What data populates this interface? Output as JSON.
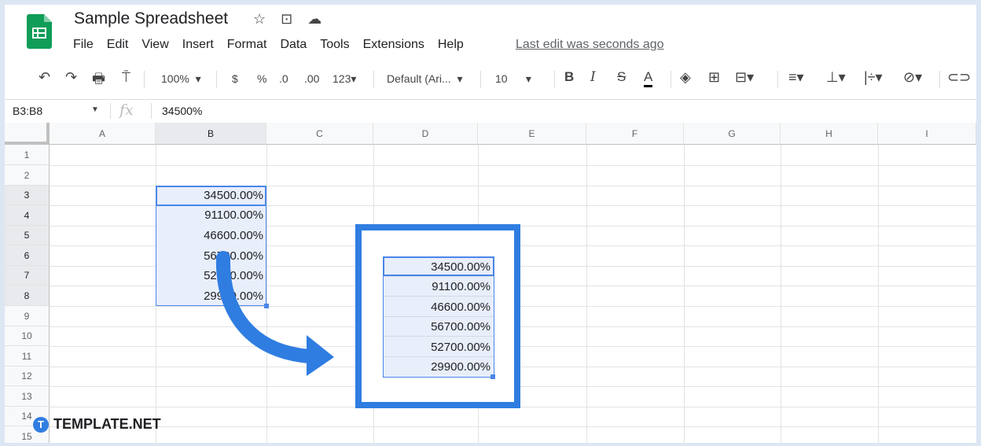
{
  "app": {
    "title": "Sample Spreadsheet",
    "last_edit": "Last edit was seconds ago"
  },
  "menu": [
    "File",
    "Edit",
    "View",
    "Insert",
    "Format",
    "Data",
    "Tools",
    "Extensions",
    "Help"
  ],
  "toolbar": {
    "zoom": "100%",
    "currency": "$",
    "percent": "%",
    "decrease_decimal": ".0",
    "increase_decimal": ".00",
    "more_formats": "123",
    "font": "Default (Ari...",
    "font_size": "10",
    "bold": "B",
    "italic": "I",
    "strike": "S",
    "text_color": "A"
  },
  "formula_bar": {
    "name_box": "B3:B8",
    "fx": "fx",
    "value": "34500%"
  },
  "columns": [
    "A",
    "B",
    "C",
    "D",
    "E",
    "F",
    "G",
    "H",
    "I"
  ],
  "rows": [
    "1",
    "2",
    "3",
    "4",
    "5",
    "6",
    "7",
    "8",
    "9",
    "10",
    "11",
    "12",
    "13",
    "14",
    "15"
  ],
  "cells_b": [
    "34500.00%",
    "91100.00%",
    "46600.00%",
    "56700.00%",
    "52700.00%",
    "29900.00%"
  ],
  "callout_cells": [
    "34500.00%",
    "91100.00%",
    "46600.00%",
    "56700.00%",
    "52700.00%",
    "29900.00%"
  ],
  "brand": {
    "badge": "T",
    "name": "TEMPLATE.NET"
  },
  "colors": {
    "accent": "#2f7de1",
    "selection": "#e8eefa",
    "sheets_green": "#0f9d58"
  }
}
